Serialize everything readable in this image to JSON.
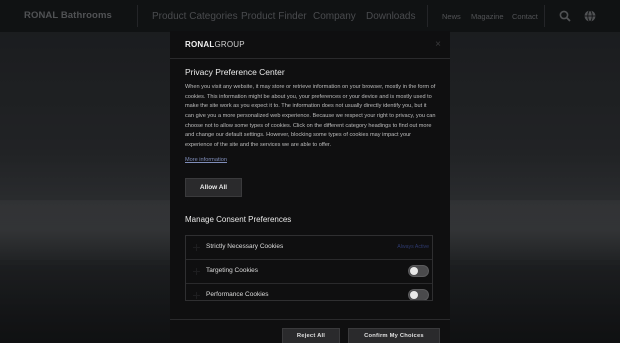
{
  "site": {
    "logo": "RONAL Bathrooms",
    "nav": [
      "Product Categories",
      "Product Finder",
      "Company",
      "Downloads"
    ],
    "nav_small": [
      "News",
      "Magazine",
      "Contact"
    ],
    "icons": [
      "search-icon",
      "globe-icon"
    ]
  },
  "modal": {
    "brand_bold": "RONAL",
    "brand_light": "GROUP",
    "close": "×",
    "title": "Privacy Preference Center",
    "description": "When you visit any website, it may store or retrieve information on your browser, mostly in the form of cookies. This information might be about you, your preferences or your device and is mostly used to make the site work as you expect it to. The information does not usually directly identify you, but it can give you a more personalized web experience. Because we respect your right to privacy, you can choose not to allow some types of cookies. Click on the different category headings to find out more and change our default settings. However, blocking some types of cookies may impact your experience of the site and the services we are able to offer.",
    "more_info": "More information",
    "allow_all": "Allow All",
    "manage_title": "Manage Consent Preferences",
    "categories": [
      {
        "label": "Strictly Necessary Cookies",
        "status": "Always Active"
      },
      {
        "label": "Targeting Cookies",
        "toggle": "off"
      },
      {
        "label": "Performance Cookies",
        "toggle": "off"
      }
    ],
    "reject_all": "Reject All",
    "confirm": "Confirm My Choices"
  },
  "colors": {
    "modal_bg": "#0f0f10",
    "button_bg": "#2a2a2c",
    "always_active": "#2e3a6e",
    "link": "#7f8db9"
  }
}
